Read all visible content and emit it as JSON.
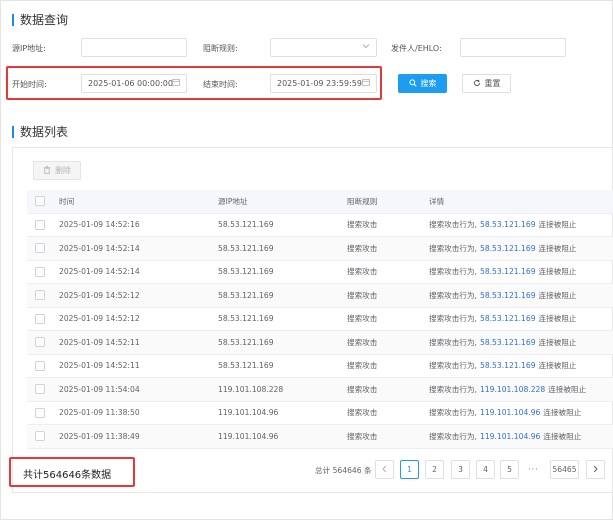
{
  "query": {
    "title": "数据查询",
    "source_ip_label": "源IP地址:",
    "source_ip_value": "",
    "rule_label": "阻断规则:",
    "rule_value": "",
    "sender_label": "发件人/EHLO:",
    "sender_value": "",
    "start_label": "开始时间:",
    "start_value": "2025-01-06 00:00:00",
    "end_label": "结束时间:",
    "end_value": "2025-01-09 23:59:59",
    "search_label": "搜索",
    "reset_label": "重置"
  },
  "list": {
    "title": "数据列表",
    "delete_label": "删除",
    "columns": [
      "时间",
      "源IP地址",
      "阻断规则",
      "详情"
    ],
    "rows": [
      {
        "time": "2025-01-09 14:52:16",
        "ip": "58.53.121.169",
        "rule": "搜索攻击",
        "detail_prefix": "搜索攻击行为,",
        "detail_ip": "58.53.121.169",
        "detail_suffix": "连接被阻止"
      },
      {
        "time": "2025-01-09 14:52:14",
        "ip": "58.53.121.169",
        "rule": "搜索攻击",
        "detail_prefix": "搜索攻击行为,",
        "detail_ip": "58.53.121.169",
        "detail_suffix": "连接被阻止"
      },
      {
        "time": "2025-01-09 14:52:14",
        "ip": "58.53.121.169",
        "rule": "搜索攻击",
        "detail_prefix": "搜索攻击行为,",
        "detail_ip": "58.53.121.169",
        "detail_suffix": "连接被阻止"
      },
      {
        "time": "2025-01-09 14:52:12",
        "ip": "58.53.121.169",
        "rule": "搜索攻击",
        "detail_prefix": "搜索攻击行为,",
        "detail_ip": "58.53.121.169",
        "detail_suffix": "连接被阻止"
      },
      {
        "time": "2025-01-09 14:52:12",
        "ip": "58.53.121.169",
        "rule": "搜索攻击",
        "detail_prefix": "搜索攻击行为,",
        "detail_ip": "58.53.121.169",
        "detail_suffix": "连接被阻止"
      },
      {
        "time": "2025-01-09 14:52:11",
        "ip": "58.53.121.169",
        "rule": "搜索攻击",
        "detail_prefix": "搜索攻击行为,",
        "detail_ip": "58.53.121.169",
        "detail_suffix": "连接被阻止"
      },
      {
        "time": "2025-01-09 14:52:11",
        "ip": "58.53.121.169",
        "rule": "搜索攻击",
        "detail_prefix": "搜索攻击行为,",
        "detail_ip": "58.53.121.169",
        "detail_suffix": "连接被阻止"
      },
      {
        "time": "2025-01-09 11:54:04",
        "ip": "119.101.108.228",
        "rule": "搜索攻击",
        "detail_prefix": "搜索攻击行为,",
        "detail_ip": "119.101.108.228",
        "detail_suffix": "连接被阻止"
      },
      {
        "time": "2025-01-09 11:38:50",
        "ip": "119.101.104.96",
        "rule": "搜索攻击",
        "detail_prefix": "搜索攻击行为,",
        "detail_ip": "119.101.104.96",
        "detail_suffix": "连接被阻止"
      },
      {
        "time": "2025-01-09 11:38:49",
        "ip": "119.101.104.96",
        "rule": "搜索攻击",
        "detail_prefix": "搜索攻击行为,",
        "detail_ip": "119.101.104.96",
        "detail_suffix": "连接被阻止"
      }
    ]
  },
  "footer": {
    "count_note": "共计564646条数据",
    "total_label": "总计 564646 条",
    "pages": [
      "1",
      "2",
      "3",
      "4",
      "5"
    ],
    "ellipsis": "···",
    "last_page": "56465",
    "prev_icon": "chevron-left-icon",
    "next_icon": "chevron-right-icon"
  },
  "colors": {
    "accent": "#1e9cf0",
    "highlight_box": "#e53935",
    "link": "#2f6fdd"
  }
}
